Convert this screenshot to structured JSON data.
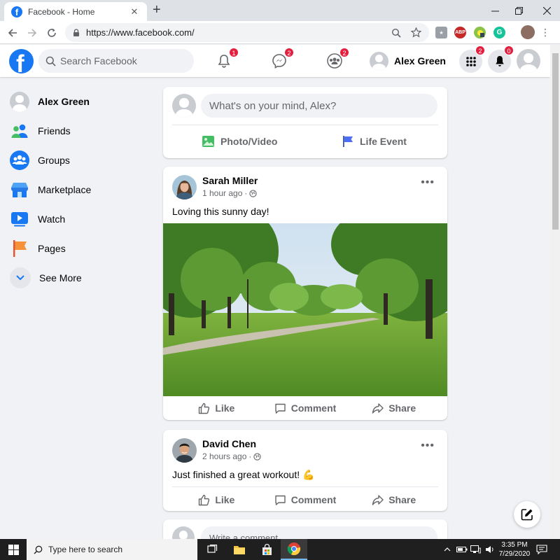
{
  "browser": {
    "tab_title": "Facebook - Home",
    "tab_close": "✕",
    "new_tab": "+",
    "url": "https://www.facebook.com/",
    "ext_abp": "ABP",
    "ext_g": "G"
  },
  "header": {
    "logo_letter": "f",
    "search_placeholder": "Search Facebook",
    "notifications_badge": "1",
    "messenger_badge": "2",
    "groups_badge": "2",
    "profile_name": "Alex Green",
    "menu_badge": "2",
    "alerts_badge": "0"
  },
  "sidebar": {
    "items": [
      {
        "label": "Alex Green"
      },
      {
        "label": "Friends"
      },
      {
        "label": "Groups"
      },
      {
        "label": "Marketplace"
      },
      {
        "label": "Watch"
      },
      {
        "label": "Pages"
      },
      {
        "label": "See More"
      }
    ]
  },
  "composer": {
    "placeholder": "What's on your mind, Alex?",
    "photo_video": "Photo/Video",
    "life_event": "Life Event"
  },
  "posts": [
    {
      "author": "Sarah Miller",
      "time": "1 hour ago",
      "text": "Loving this sunny day!",
      "like": "Like",
      "comment": "Comment",
      "share": "Share"
    },
    {
      "author": "David Chen",
      "time": "2 hours ago",
      "text": "Just finished a great workout! 💪",
      "like": "Like",
      "comment": "Comment",
      "share": "Share"
    }
  ],
  "comment_box": {
    "placeholder": "Write a comment..."
  },
  "taskbar": {
    "search_placeholder": "Type here to search",
    "time": "3:35 PM",
    "date": "7/29/2020"
  },
  "colors": {
    "brand": "#1877f2",
    "badge": "#e41e3f",
    "feed_bg": "#f0f2f5"
  }
}
